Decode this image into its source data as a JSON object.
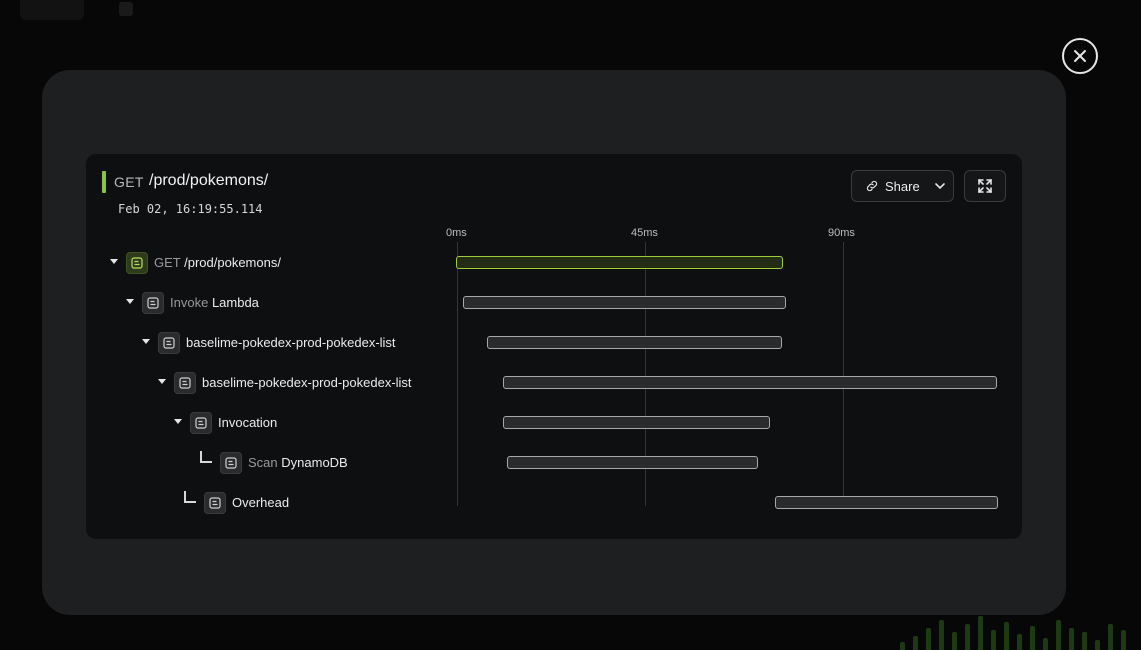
{
  "trace": {
    "method": "GET",
    "path": "/prod/pokemons/",
    "timestamp": "Feb 02, 16:19:55.114",
    "accent_color": "#8bc34a"
  },
  "toolbar": {
    "share_label": "Share"
  },
  "timeline": {
    "ticks": [
      "0ms",
      "45ms",
      "90ms"
    ]
  },
  "spans": [
    {
      "prefix": "GET",
      "name": "/prod/pokemons/"
    },
    {
      "prefix": "Invoke",
      "name": "Lambda"
    },
    {
      "prefix": "",
      "name": "baselime-pokedex-prod-pokedex-list"
    },
    {
      "prefix": "",
      "name": "baselime-pokedex-prod-pokedex-list"
    },
    {
      "prefix": "",
      "name": "Invocation"
    },
    {
      "prefix": "Scan",
      "name": "DynamoDB"
    },
    {
      "prefix": "",
      "name": "Overhead"
    }
  ],
  "icons": {
    "close": "close-icon",
    "share": "link-icon",
    "dropdown": "chevron-down-icon",
    "expand": "expand-icon",
    "span": "span-icon"
  }
}
